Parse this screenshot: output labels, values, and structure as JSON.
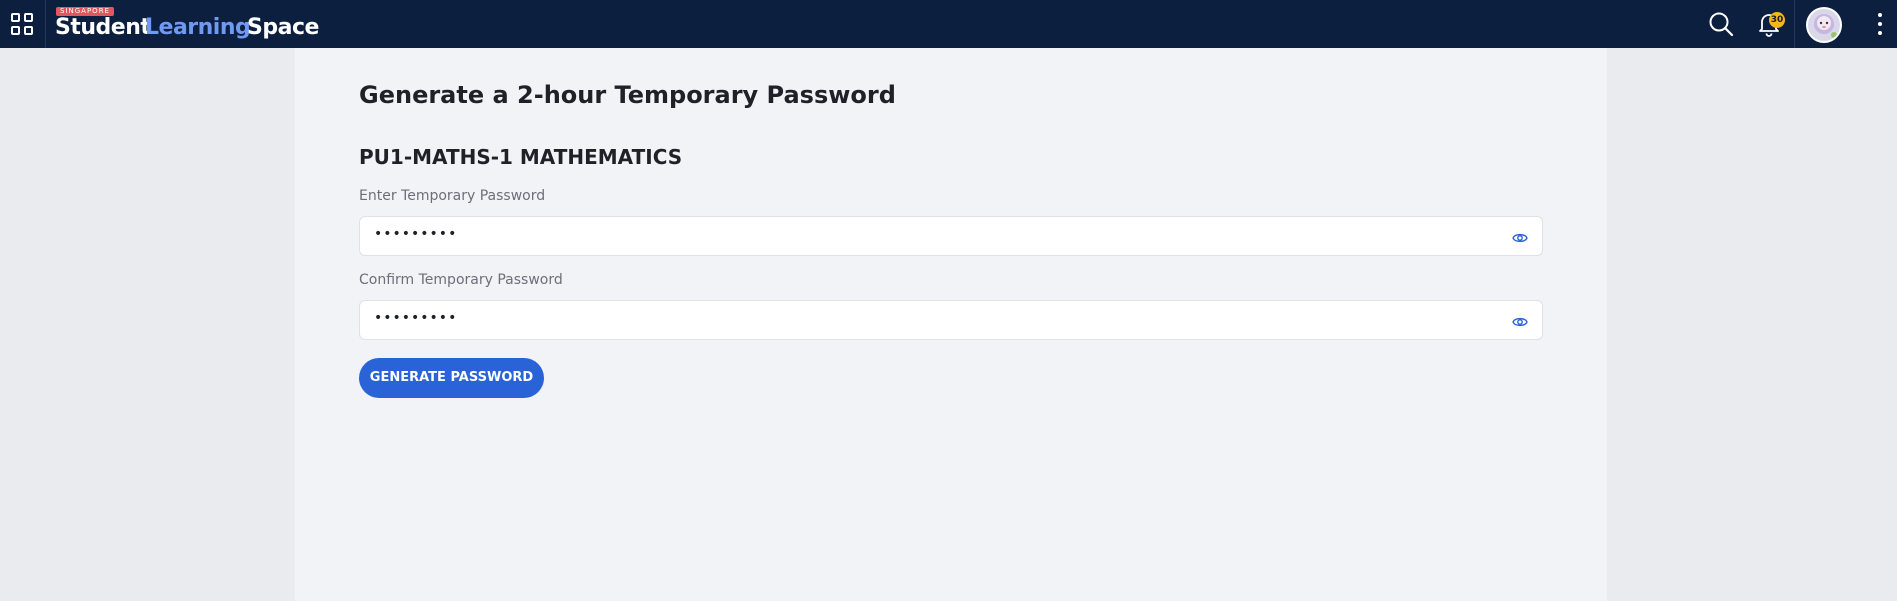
{
  "header": {
    "logo_tag": "SINGAPORE",
    "logo_word_1": "Student",
    "logo_word_2": "Learning",
    "logo_word_3": "Space",
    "notification_count": "30"
  },
  "main": {
    "title": "Generate a 2-hour Temporary Password",
    "class_name": "PU1-MATHS-1 MATHEMATICS",
    "password_label": "Enter Temporary Password",
    "password_value": "•••••••••",
    "confirm_label": "Confirm Temporary Password",
    "confirm_value": "•••••••••",
    "generate_button": "GENERATE PASSWORD"
  },
  "icons": {
    "apps": "apps-grid-icon",
    "search": "search-icon",
    "notifications": "bell-icon",
    "menu": "more-vertical-icon",
    "reveal": "eye-icon"
  },
  "colors": {
    "header_bg": "#0d1f3f",
    "brand_blue": "#6f99f2",
    "button_blue": "#2a63d8",
    "badge": "#f2b71d",
    "tag_red": "#e0575d"
  }
}
